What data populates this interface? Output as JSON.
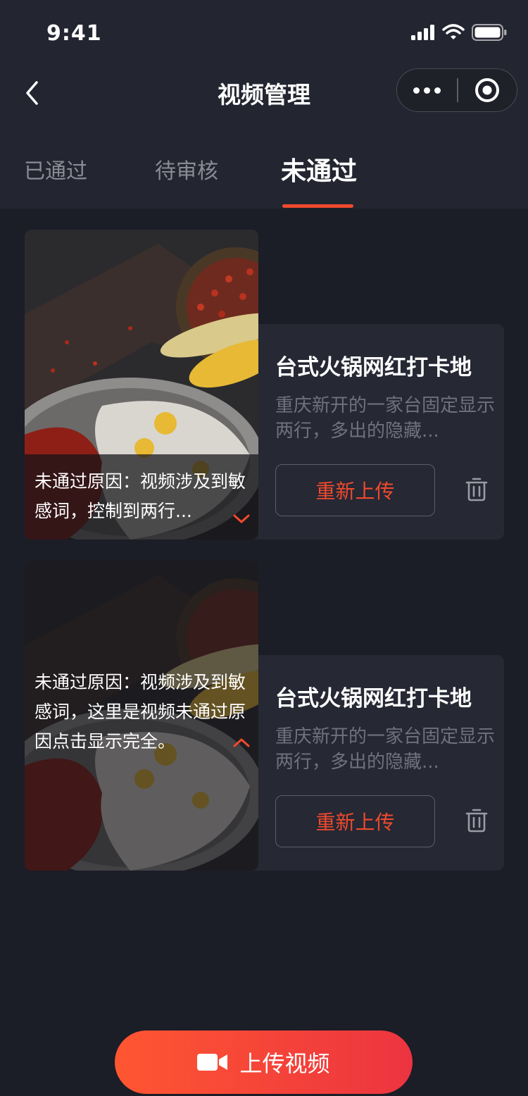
{
  "status": {
    "time": "9:41"
  },
  "nav": {
    "title": "视频管理"
  },
  "tabs": [
    {
      "label": "已通过",
      "active": false
    },
    {
      "label": "待审核",
      "active": false
    },
    {
      "label": "未通过",
      "active": true
    }
  ],
  "cards": [
    {
      "title": "台式火锅网红打卡地",
      "desc": "重庆新开的一家台固定显示两行，多出的隐藏...",
      "reason": "未通过原因：视频涉及到敏感词，控制到两行...",
      "reason_expanded": false,
      "reupload_label": "重新上传"
    },
    {
      "title": "台式火锅网红打卡地",
      "desc": "重庆新开的一家台固定显示两行，多出的隐藏...",
      "reason": "未通过原因：视频涉及到敏感词，这里是视频未通过原因点击显示完全。",
      "reason_expanded": true,
      "reupload_label": "重新上传"
    }
  ],
  "upload": {
    "label": "上传视频"
  },
  "colors": {
    "accent": "#f04a2c",
    "background": "#1b1d27",
    "header": "#232530",
    "card": "#262834"
  },
  "icons": [
    "back-arrow-icon",
    "more-dots-icon",
    "target-close-icon",
    "chevron-down-icon",
    "chevron-up-icon",
    "trash-icon",
    "video-camera-icon",
    "signal-icon",
    "wifi-icon",
    "battery-icon"
  ]
}
